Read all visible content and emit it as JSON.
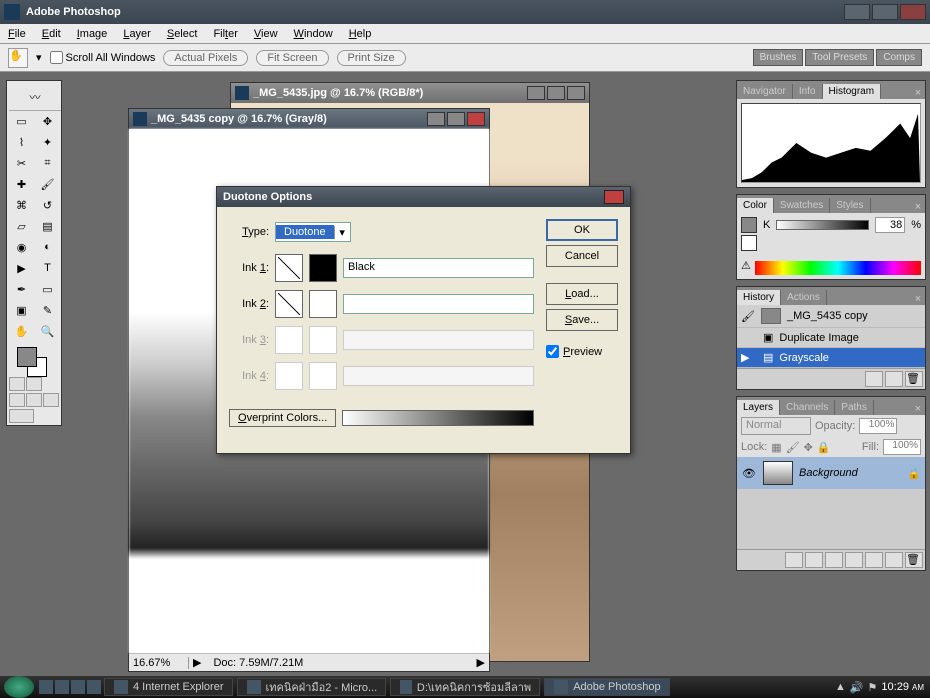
{
  "app": {
    "title": "Adobe Photoshop"
  },
  "menus": [
    "File",
    "Edit",
    "Image",
    "Layer",
    "Select",
    "Filter",
    "View",
    "Window",
    "Help"
  ],
  "options": {
    "scroll_all": "Scroll All Windows",
    "btn_actual": "Actual Pixels",
    "btn_fit": "Fit Screen",
    "btn_print": "Print Size"
  },
  "top_tabs": [
    "Brushes",
    "Tool Presets",
    "Comps"
  ],
  "doc_back": {
    "title": "_MG_5435.jpg @ 16.7% (RGB/8*)"
  },
  "doc_front": {
    "title": "_MG_5435 copy @ 16.7% (Gray/8)",
    "zoom": "16.67%",
    "status": "Doc: 7.59M/7.21M"
  },
  "dialog": {
    "title": "Duotone Options",
    "type_label": "Type:",
    "type_value": "Duotone",
    "inks": [
      {
        "label": "Ink 1:",
        "name": "Black",
        "color": "#000000",
        "enabled": true
      },
      {
        "label": "Ink 2:",
        "name": "",
        "color": "#ffffff",
        "enabled": true
      },
      {
        "label": "Ink 3:",
        "name": "",
        "color": "#ffffff",
        "enabled": false
      },
      {
        "label": "Ink 4:",
        "name": "",
        "color": "#ffffff",
        "enabled": false
      }
    ],
    "overprint": "Overprint Colors...",
    "ok": "OK",
    "cancel": "Cancel",
    "load": "Load...",
    "save": "Save...",
    "preview": "Preview",
    "preview_checked": true
  },
  "nav_panel": {
    "tabs": [
      "Navigator",
      "Info",
      "Histogram"
    ],
    "active": 2
  },
  "color_panel": {
    "tabs": [
      "Color",
      "Swatches",
      "Styles"
    ],
    "active": 0,
    "channel": "K",
    "value": "38",
    "pct": "%"
  },
  "history_panel": {
    "tabs": [
      "History",
      "Actions"
    ],
    "active": 0,
    "snapshot": "_MG_5435 copy",
    "items": [
      {
        "label": "Duplicate Image",
        "selected": false
      },
      {
        "label": "Grayscale",
        "selected": true
      }
    ]
  },
  "layers_panel": {
    "tabs": [
      "Layers",
      "Channels",
      "Paths"
    ],
    "active": 0,
    "blend": "Normal",
    "opacity_label": "Opacity:",
    "opacity": "100%",
    "lock_label": "Lock:",
    "fill_label": "Fill:",
    "fill": "100%",
    "layer_name": "Background"
  },
  "taskbar": {
    "items": [
      {
        "label": "4 Internet Explorer"
      },
      {
        "label": "เทคนิคฝ่ามือ2 - Micro..."
      },
      {
        "label": "D:\\เทคนิคการซ้อมลีลาพ"
      },
      {
        "label": "Adobe Photoshop",
        "active": true
      }
    ],
    "time": "10:29",
    "ampm": "AM"
  }
}
